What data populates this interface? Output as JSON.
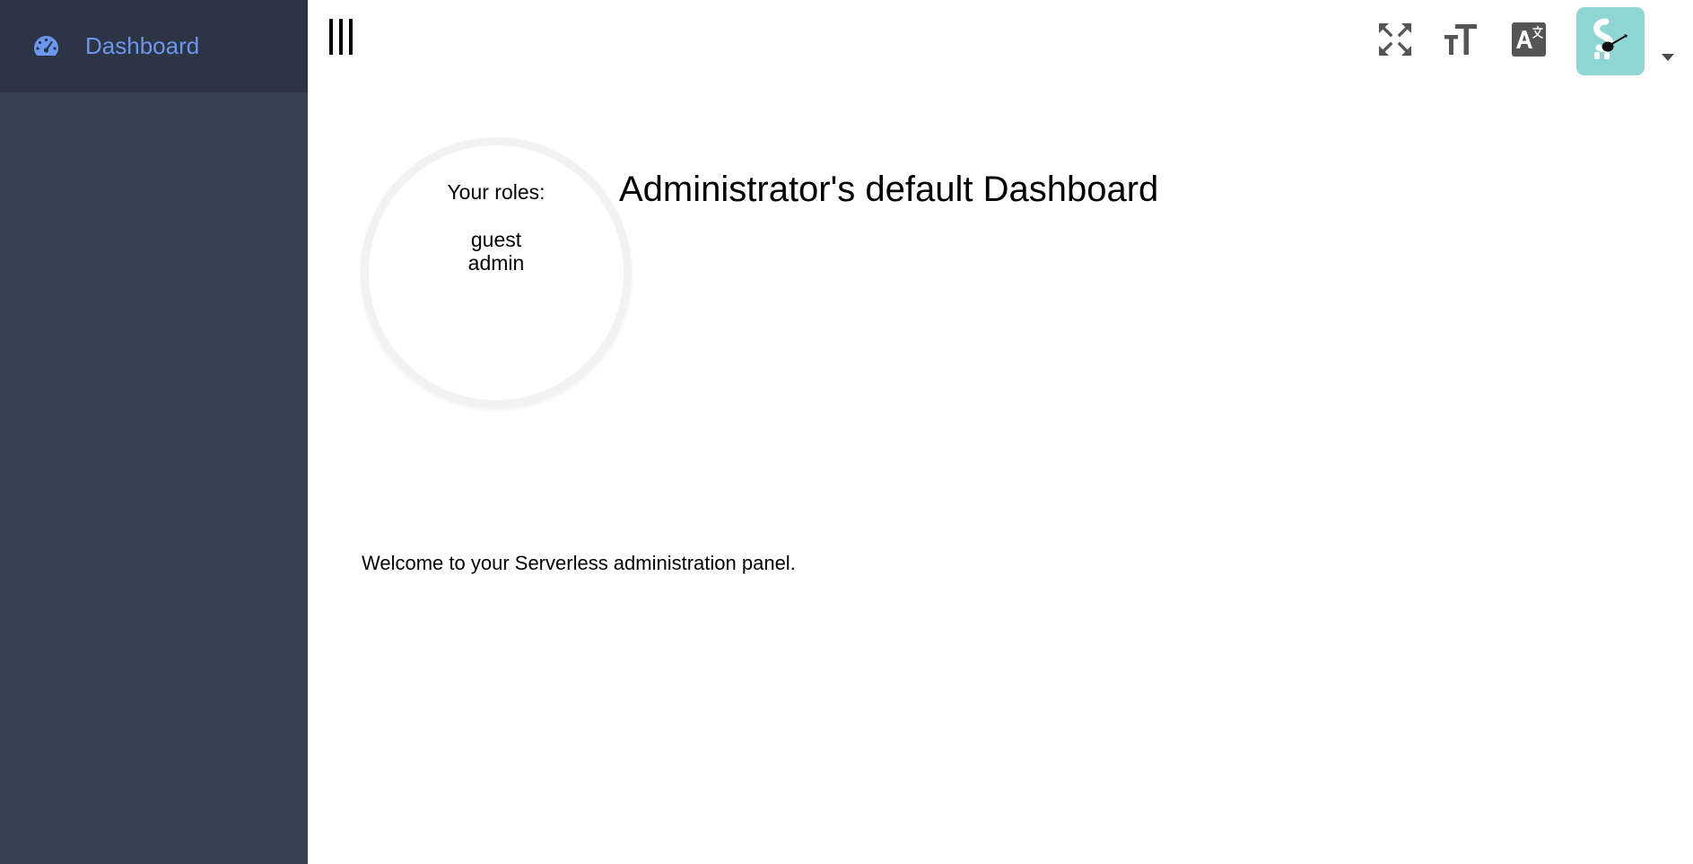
{
  "sidebar": {
    "items": [
      {
        "label": "Dashboard",
        "icon": "dashboard-gauge-icon",
        "active": true
      }
    ]
  },
  "header": {
    "menu_icon": "hamburger-menu-icon",
    "actions": [
      {
        "icon": "fullscreen-icon"
      },
      {
        "icon": "font-size-icon"
      },
      {
        "icon": "translate-icon"
      }
    ],
    "avatar_icon": "user-avatar-icon",
    "dropdown_icon": "caret-down-icon"
  },
  "main": {
    "roles_title": "Your roles:",
    "roles": [
      "guest",
      "admin"
    ],
    "title": "Administrator's default Dashboard",
    "welcome": "Welcome to your Serverless administration panel."
  },
  "colors": {
    "sidebar_bg": "#374053",
    "sidebar_header_bg": "#2d3444",
    "sidebar_active_text": "#6b96f0",
    "avatar_bg": "#8ed6d3",
    "icon_gray": "#555555"
  }
}
